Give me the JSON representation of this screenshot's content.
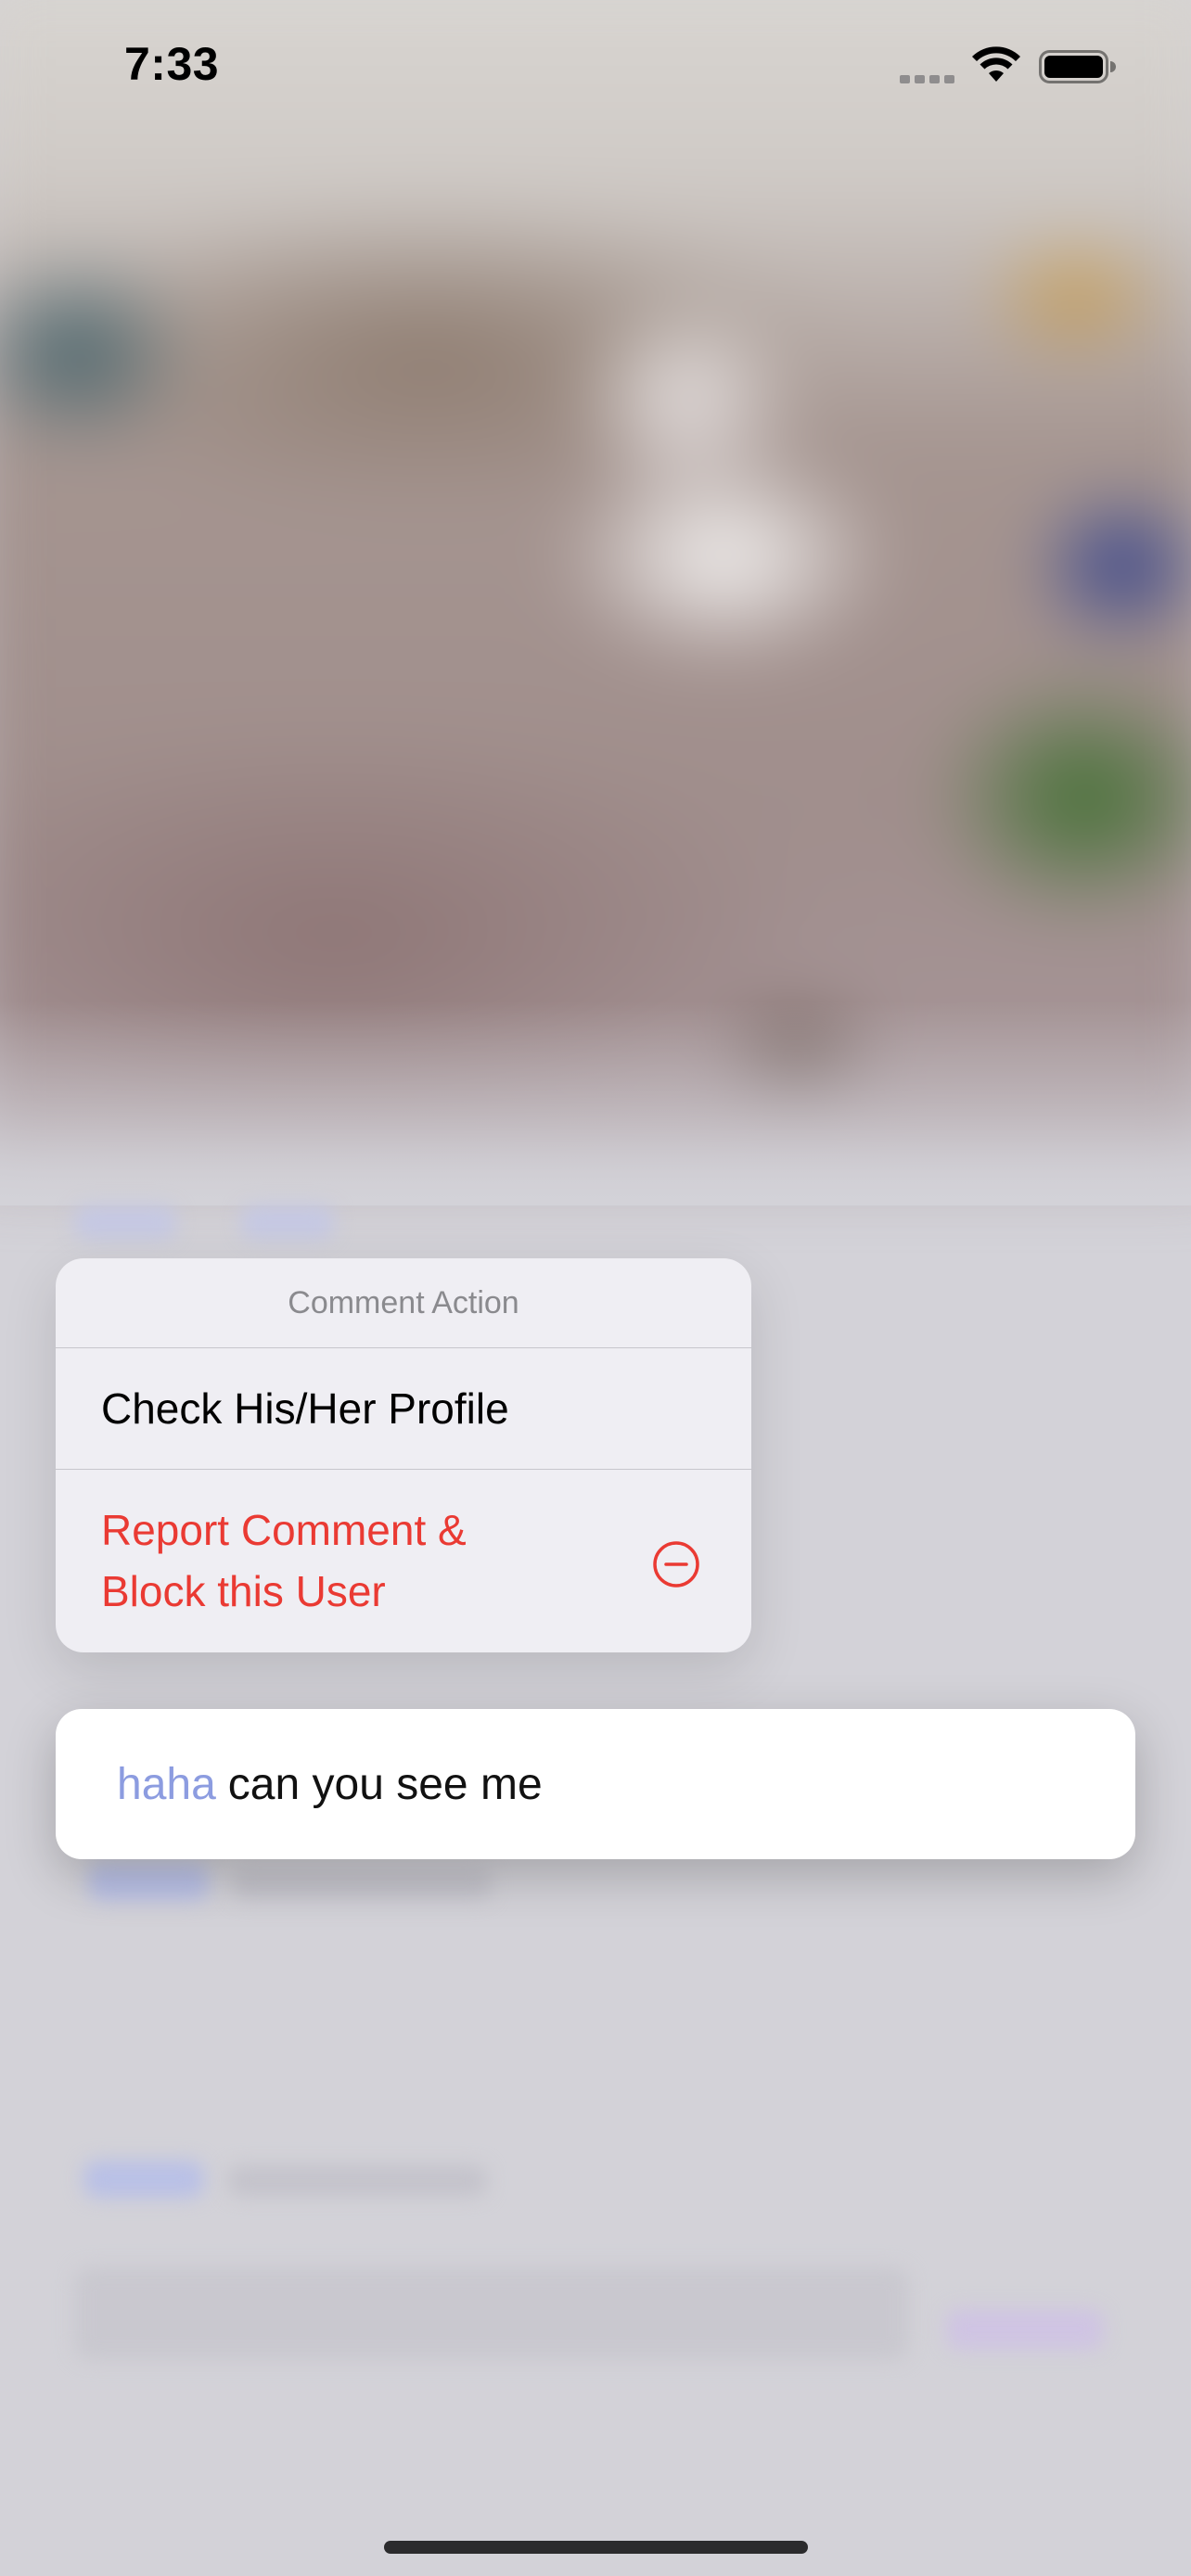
{
  "status_bar": {
    "time": "7:33",
    "icons": [
      "cellular-signal-icon",
      "wifi-icon",
      "battery-icon"
    ]
  },
  "context_menu": {
    "title": "Comment Action",
    "items": [
      {
        "label": "Check His/Her Profile",
        "color": "#000000"
      },
      {
        "label_lines": [
          "Report Comment &",
          "Block this User"
        ],
        "icon": "minus-circle-icon",
        "color": "#EA3A33"
      }
    ]
  },
  "comment": {
    "username": "haha",
    "text": "can you see me",
    "username_color": "#8C9CE0"
  },
  "colors": {
    "menu_background": "#EFEEF3",
    "destructive": "#EA3A33",
    "card_background": "#FFFFFF"
  }
}
